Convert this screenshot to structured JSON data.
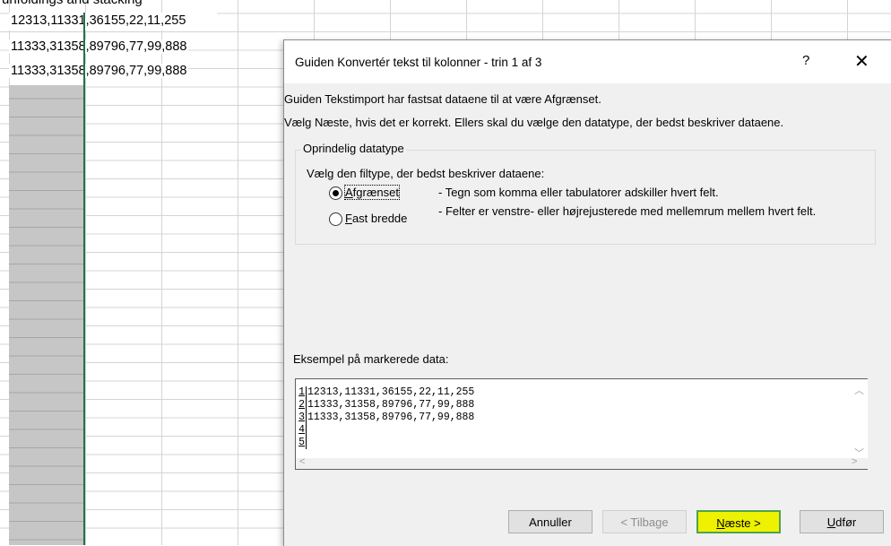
{
  "sheet": {
    "top_cut_text": "unfoldings and stacking",
    "rows": [
      "12313,11331,36155,22,11,255",
      "11333,31358,89796,77,99,888",
      "11333,31358,89796,77,99,888"
    ]
  },
  "dialog": {
    "title": "Guiden Konvertér tekst til kolonner - trin 1 af 3",
    "help": "?",
    "close": "✕",
    "line1": "Guiden Tekstimport har fastsat dataene til at være Afgrænset.",
    "line2": "Vælg Næste, hvis det er korrekt. Ellers skal du vælge den datatype, der bedst beskriver dataene.",
    "group_title": "Oprindelig datatype",
    "group_prompt": "Vælg den filtype, der bedst beskriver dataene:",
    "option1": {
      "label": "Afgrænset",
      "desc": "- Tegn som komma eller tabulatorer adskiller hvert felt.",
      "selected": true
    },
    "option2": {
      "label": "Fast bredde",
      "desc": "- Felter er venstre- eller højrejusterede med mellemrum mellem hvert felt.",
      "selected": false
    },
    "preview_label": "Eksempel på markerede data:",
    "preview_lines": [
      {
        "num": "1",
        "text": "12313,11331,36155,22,11,255"
      },
      {
        "num": "2",
        "text": "11333,31358,89796,77,99,888"
      },
      {
        "num": "3",
        "text": "11333,31358,89796,77,99,888"
      },
      {
        "num": "4",
        "text": ""
      },
      {
        "num": "5",
        "text": ""
      }
    ],
    "buttons": {
      "cancel": "Annuller",
      "back": "< Tilbage",
      "next": "Næste >",
      "finish": "Udfør"
    }
  }
}
